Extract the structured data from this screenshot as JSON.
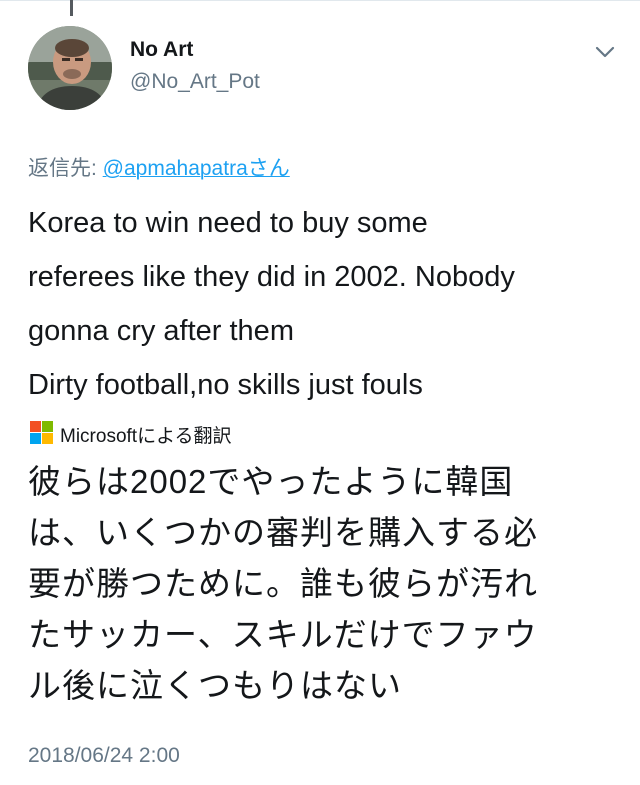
{
  "tweet": {
    "display_name": "No Art",
    "handle": "@No_Art_Pot",
    "reply_prefix": "返信先: ",
    "reply_mention": "@apmahapatra",
    "reply_suffix": "さん",
    "text_lines": [
      "Korea to win need to buy some",
      "referees like they did in 2002. Nobody",
      "gonna cry after them",
      "Dirty football,no skills just fouls"
    ],
    "translate_label": "Microsoftによる翻訳",
    "translation_lines": [
      "彼らは2002でやったように韓国",
      "は、いくつかの審判を購入する必",
      "要が勝つために。誰も彼らが汚れ",
      "たサッカー、スキルだけでファウ",
      "ル後に泣くつもりはない"
    ],
    "timestamp": "2018/06/24 2:00"
  },
  "icons": {
    "menu": "chevron-down-icon",
    "translator": "microsoft-logo-icon"
  },
  "colors": {
    "link": "#1da1f2",
    "secondary_text": "#657786",
    "primary_text": "#14171a",
    "ms_red": "#f25022",
    "ms_green": "#7fba00",
    "ms_blue": "#00a4ef",
    "ms_yellow": "#ffb900"
  }
}
